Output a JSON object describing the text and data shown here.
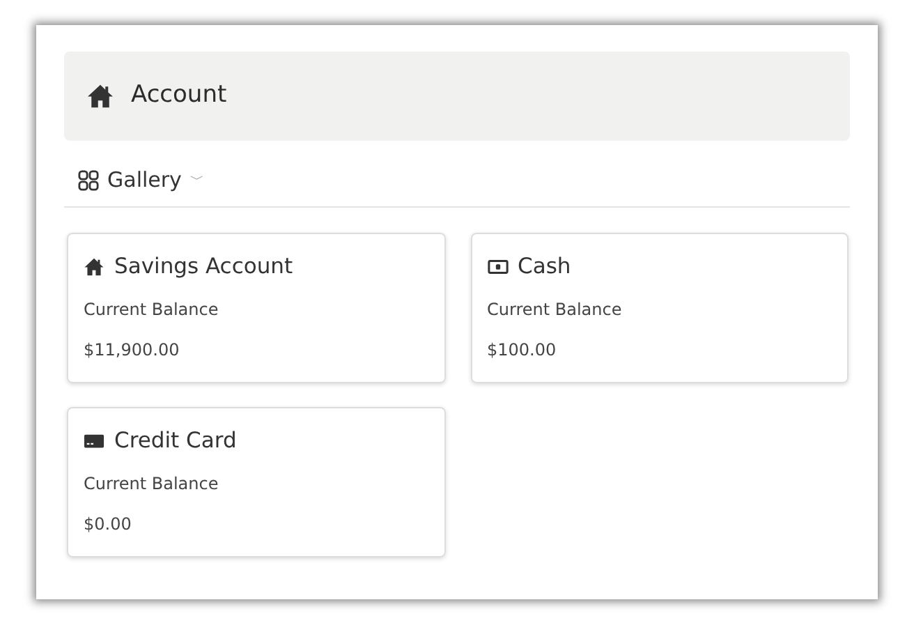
{
  "header": {
    "title": "Account"
  },
  "view_switcher": {
    "label": "Gallery",
    "caret": "﹀"
  },
  "accounts": [
    {
      "name": "Savings Account",
      "kind": "home",
      "label": "Current Balance",
      "balance": "$11,900.00"
    },
    {
      "name": "Cash",
      "kind": "cash",
      "label": "Current Balance",
      "balance": "$100.00"
    },
    {
      "name": "Credit Card",
      "kind": "card",
      "label": "Current Balance",
      "balance": "$0.00"
    }
  ]
}
